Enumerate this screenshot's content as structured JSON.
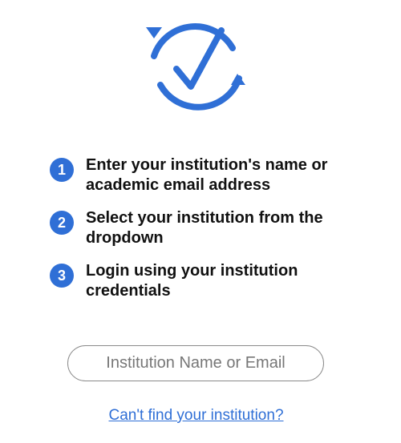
{
  "colors": {
    "accent": "#2f6fd6",
    "text": "#111111",
    "input_border": "#8a8a8a",
    "placeholder": "#777777"
  },
  "logo": {
    "icon": "checkmark-refresh-icon"
  },
  "steps": [
    {
      "number": "1",
      "text": "Enter your institution's name or academic email address"
    },
    {
      "number": "2",
      "text": "Select your institution from the dropdown"
    },
    {
      "number": "3",
      "text": "Login using your institution credentials"
    }
  ],
  "search": {
    "value": "",
    "placeholder": "Institution Name or Email"
  },
  "help_link": {
    "label": "Can't find your institution?"
  }
}
